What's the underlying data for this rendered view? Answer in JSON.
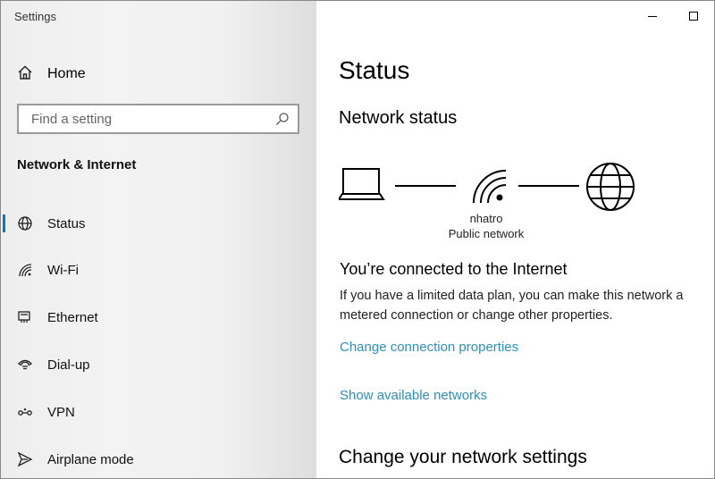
{
  "window": {
    "title": "Settings"
  },
  "sidebar": {
    "home_label": "Home",
    "search": {
      "placeholder": "Find a setting",
      "value": ""
    },
    "section": "Network & Internet",
    "items": [
      {
        "label": "Status",
        "icon": "globe-icon",
        "selected": true
      },
      {
        "label": "Wi-Fi",
        "icon": "wifi-icon"
      },
      {
        "label": "Ethernet",
        "icon": "ethernet-icon"
      },
      {
        "label": "Dial-up",
        "icon": "phone-icon"
      },
      {
        "label": "VPN",
        "icon": "vpn-icon"
      },
      {
        "label": "Airplane mode",
        "icon": "airplane-icon"
      }
    ],
    "accent_color": "#0078d7"
  },
  "main": {
    "title": "Status",
    "network_status_heading": "Network status",
    "network": {
      "name": "nhatro",
      "type": "Public network"
    },
    "connected_title": "You’re connected to the Internet",
    "connected_desc": "If you have a limited data plan, you can make this network a metered connection or change other properties.",
    "links": {
      "change_connection": "Change connection properties",
      "show_networks": "Show available networks"
    },
    "change_settings_heading": "Change your network settings",
    "link_color": "#2d8fbd"
  }
}
